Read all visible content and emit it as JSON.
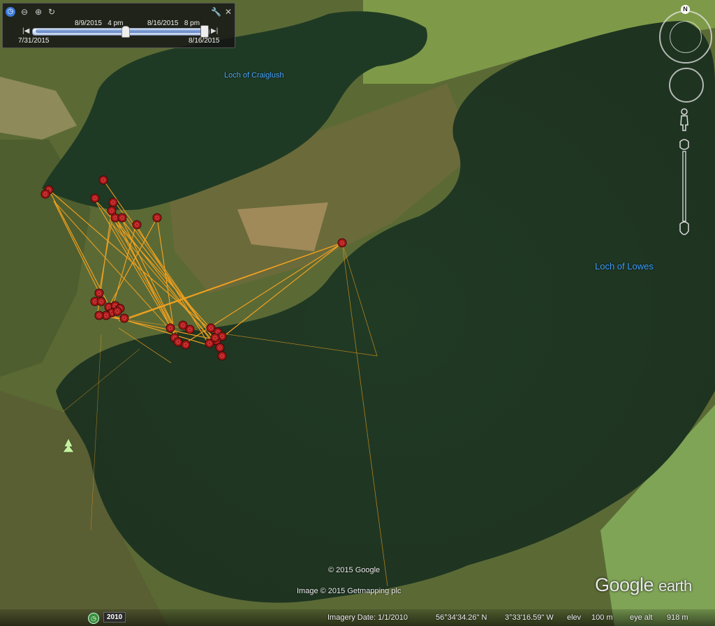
{
  "map": {
    "labels": {
      "loch_north": "Loch of Craiglush",
      "loch_main": "Loch of Lowes"
    },
    "track_color": "#f0a020",
    "marker_color": "#a81818"
  },
  "time_slider": {
    "range_start": "8/9/2015   4 pm",
    "range_end": "8/16/2015   8 pm",
    "span_start": "7/31/2015",
    "span_end": "8/16/2015",
    "icons": [
      "clock-icon",
      "zoom-out-icon",
      "zoom-in-icon",
      "refresh-icon",
      "wrench-icon",
      "close-icon"
    ]
  },
  "nav": {
    "north": "N"
  },
  "attribution": {
    "copyright": "© 2015 Google",
    "imagery": "Image © 2015 Getmapping plc",
    "logo_main": "Google",
    "logo_sub": "earth"
  },
  "status": {
    "history_year": "2010",
    "imagery_date": "Imagery Date: 1/1/2010",
    "lat": "56°34'34.26\" N",
    "lon": "3°33'16.59\" W",
    "elev_label": "elev",
    "elev_value": "100 m",
    "eye_label": "eye alt",
    "eye_value": "918 m"
  }
}
